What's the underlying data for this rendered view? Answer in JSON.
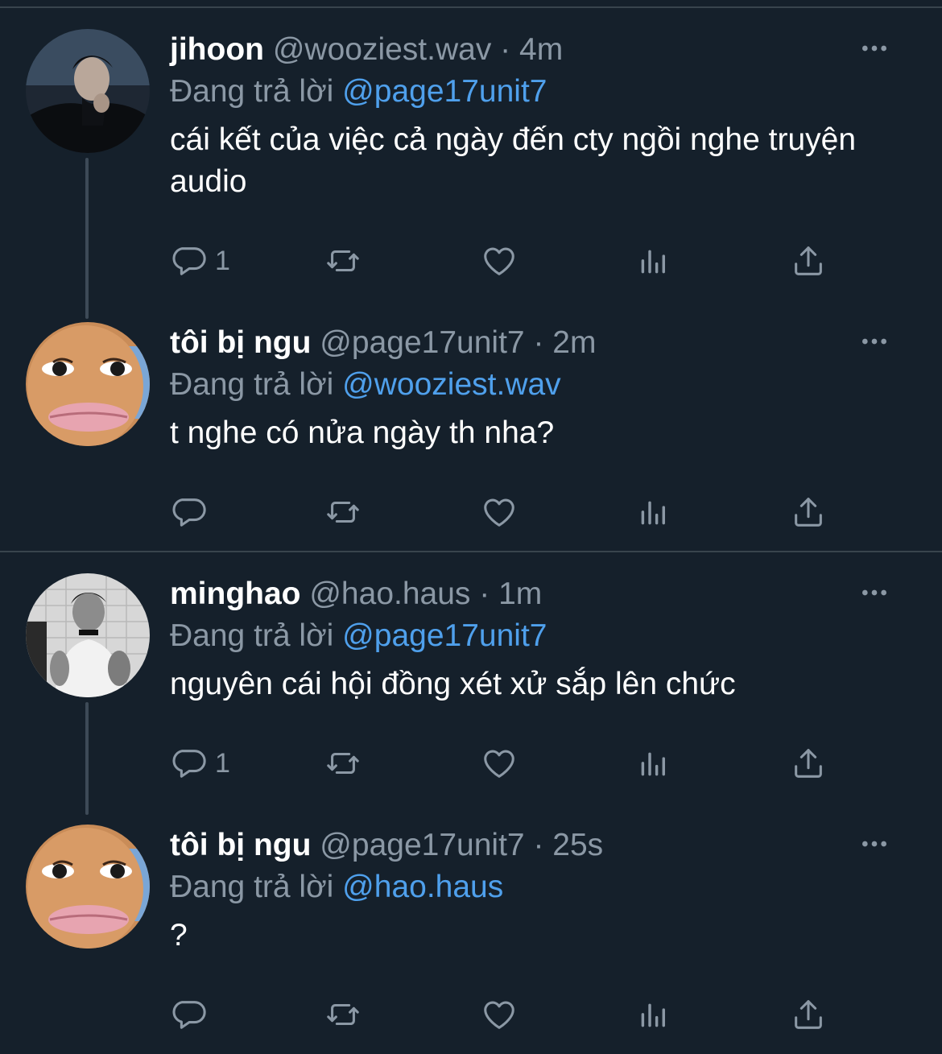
{
  "tweets": [
    {
      "name": "jihoon",
      "handle": "@wooziest.wav",
      "separator": "·",
      "time": "4m",
      "replying_label": "Đang trả lời",
      "replying_to": "@page17unit7",
      "text": "cái kết của việc cả ngày đến cty ngồi nghe truyện audio",
      "reply_count": "1",
      "avatar": "dark-photo-avatar"
    },
    {
      "name": "tôi bị ngu",
      "handle": "@page17unit7",
      "separator": "·",
      "time": "2m",
      "replying_label": "Đang trả lời",
      "replying_to": "@wooziest.wav",
      "text": "t nghe có nửa ngày th nha?",
      "reply_count": "",
      "avatar": "cartoon-face-avatar"
    },
    {
      "name": "minghao",
      "handle": "@hao.haus",
      "separator": "·",
      "time": "1m",
      "replying_label": "Đang trả lời",
      "replying_to": "@page17unit7",
      "text": "nguyên cái hội đồng xét xử sắp lên chức",
      "reply_count": "1",
      "avatar": "bw-photo-avatar"
    },
    {
      "name": "tôi bị ngu",
      "handle": "@page17unit7",
      "separator": "·",
      "time": "25s",
      "replying_label": "Đang trả lời",
      "replying_to": "@hao.haus",
      "text": "?",
      "reply_count": "",
      "avatar": "cartoon-face-avatar"
    }
  ],
  "icons": [
    "reply-icon",
    "retweet-icon",
    "like-icon",
    "views-icon",
    "share-icon",
    "more-icon"
  ],
  "colors": {
    "background": "#15202b",
    "muted": "#8b98a5",
    "mention": "#4fa0ec",
    "divider": "#38444d"
  }
}
